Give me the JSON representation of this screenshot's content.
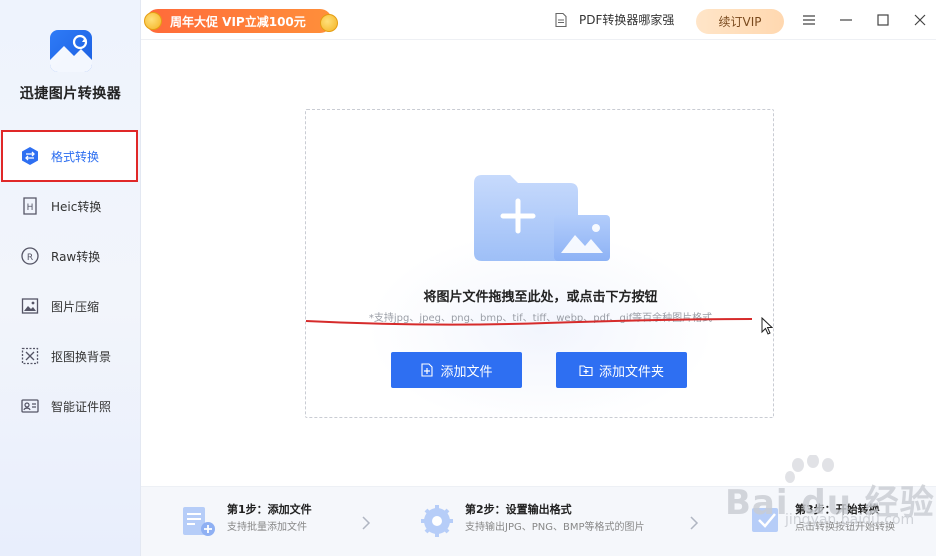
{
  "app": {
    "name": "迅捷图片转换器"
  },
  "sidebar": {
    "items": [
      {
        "label": "格式转换",
        "icon": "swap-arrows-icon",
        "active": true
      },
      {
        "label": "Heic转换",
        "icon": "heic-file-icon",
        "active": false
      },
      {
        "label": "Raw转换",
        "icon": "raw-circle-icon",
        "active": false
      },
      {
        "label": "图片压缩",
        "icon": "image-compress-icon",
        "active": false
      },
      {
        "label": "抠图换背景",
        "icon": "cutout-icon",
        "active": false
      },
      {
        "label": "智能证件照",
        "icon": "id-photo-icon",
        "active": false
      }
    ]
  },
  "topbar": {
    "promo": "周年大促 VIP立减100元",
    "pdf_link": "PDF转换器哪家强",
    "renew": "续订VIP"
  },
  "dropzone": {
    "title": "将图片文件拖拽至此处，或点击下方按钮",
    "subtitle": "*支持jpg、jpeg、png、bmp、tif、tiff、webp、pdf、gif等百余种图片格式",
    "add_file": "添加文件",
    "add_folder": "添加文件夹"
  },
  "steps": [
    {
      "title": "第1步：添加文件",
      "desc": "支持批量添加文件"
    },
    {
      "title": "第2步：设置输出格式",
      "desc": "支持输出JPG、PNG、BMP等格式的图片"
    },
    {
      "title": "第3步：开始转换",
      "desc": "点击转换按钮开始转换"
    }
  ],
  "watermark": {
    "brand": "Bai du 经验",
    "url": "jingyan.baidu.com"
  },
  "colors": {
    "accent": "#2e6ff2",
    "highlight_border": "#e02828",
    "promo": "#ff6a3a"
  }
}
